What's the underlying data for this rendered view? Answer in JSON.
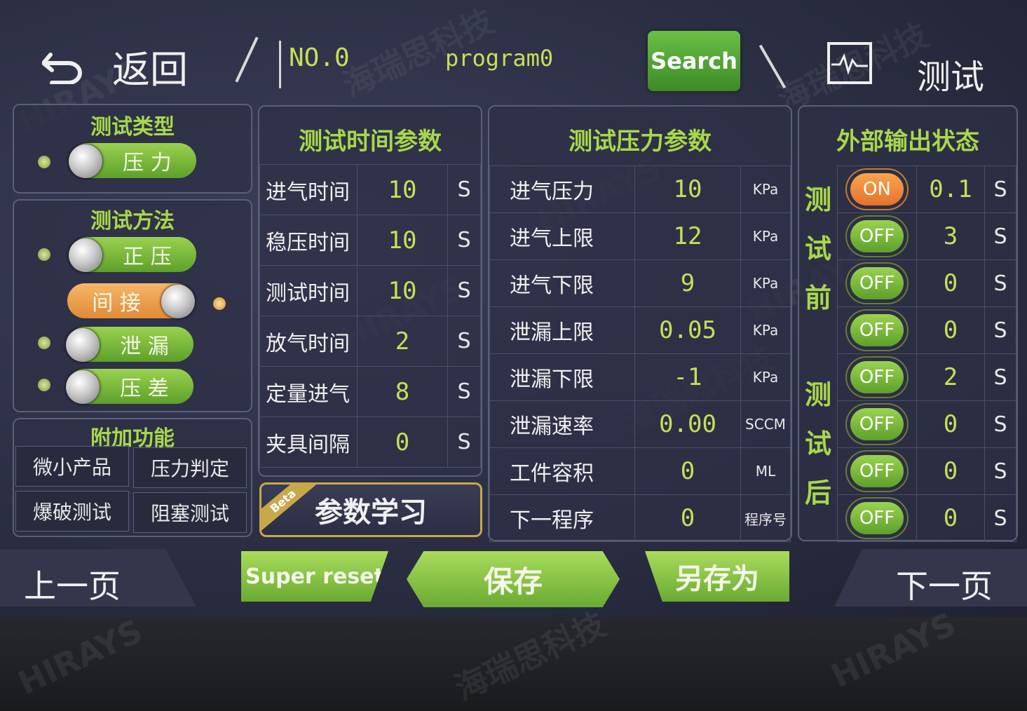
{
  "header": {
    "back_label": "返回",
    "program_no": "NO.0",
    "program_name": "program0",
    "search_label": "Search",
    "test_label": "测试"
  },
  "left": {
    "test_type_title": "测试类型",
    "test_type_option": "压  力",
    "test_method_title": "测试方法",
    "methods": [
      "正  压",
      "间  接",
      "泄  漏",
      "压  差"
    ],
    "extra_title": "附加功能",
    "extra_buttons": [
      "微小产品",
      "压力判定",
      "爆破测试",
      "阻塞测试"
    ]
  },
  "time_params": {
    "title": "测试时间参数",
    "rows": [
      {
        "label": "进气时间",
        "value": "10",
        "unit": "S"
      },
      {
        "label": "稳压时间",
        "value": "10",
        "unit": "S"
      },
      {
        "label": "测试时间",
        "value": "10",
        "unit": "S"
      },
      {
        "label": "放气时间",
        "value": "2",
        "unit": "S"
      },
      {
        "label": "定量进气",
        "value": "8",
        "unit": "S"
      },
      {
        "label": "夹具间隔",
        "value": "0",
        "unit": "S"
      }
    ]
  },
  "pressure_params": {
    "title": "测试压力参数",
    "rows": [
      {
        "label": "进气压力",
        "value": "10",
        "unit": "KPa"
      },
      {
        "label": "进气上限",
        "value": "12",
        "unit": "KPa"
      },
      {
        "label": "进气下限",
        "value": "9",
        "unit": "KPa"
      },
      {
        "label": "泄漏上限",
        "value": "0.05",
        "unit": "KPa"
      },
      {
        "label": "泄漏下限",
        "value": "-1",
        "unit": "KPa"
      },
      {
        "label": "泄漏速率",
        "value": "0.00",
        "unit": "SCCM"
      },
      {
        "label": "工件容积",
        "value": "0",
        "unit": "ML"
      },
      {
        "label": "下一程序",
        "value": "0",
        "unit": "程序号"
      }
    ]
  },
  "output": {
    "title": "外部输出状态",
    "before_label": [
      "测",
      "试",
      "前"
    ],
    "after_label": [
      "测",
      "试",
      "后"
    ],
    "rows": [
      {
        "state": "ON",
        "value": "0.1",
        "unit": "S"
      },
      {
        "state": "OFF",
        "value": "3",
        "unit": "S"
      },
      {
        "state": "OFF",
        "value": "0",
        "unit": "S"
      },
      {
        "state": "OFF",
        "value": "0",
        "unit": "S"
      },
      {
        "state": "OFF",
        "value": "2",
        "unit": "S"
      },
      {
        "state": "OFF",
        "value": "0",
        "unit": "S"
      },
      {
        "state": "OFF",
        "value": "0",
        "unit": "S"
      },
      {
        "state": "OFF",
        "value": "0",
        "unit": "S"
      }
    ]
  },
  "learn": {
    "beta": "Beta",
    "label": "参数学习"
  },
  "footer": {
    "prev": "上一页",
    "super_reset": "Super reset",
    "save": "保存",
    "save_as": "另存为",
    "next": "下一页"
  },
  "watermark": {
    "brand": "HIRAYS",
    "cn": "海瑞思科技"
  },
  "colors": {
    "accent_green": "#a8d84a",
    "value_yellow": "#c4e05a",
    "on_orange": "#e5722a",
    "screen_bg": "#2c2f44"
  }
}
